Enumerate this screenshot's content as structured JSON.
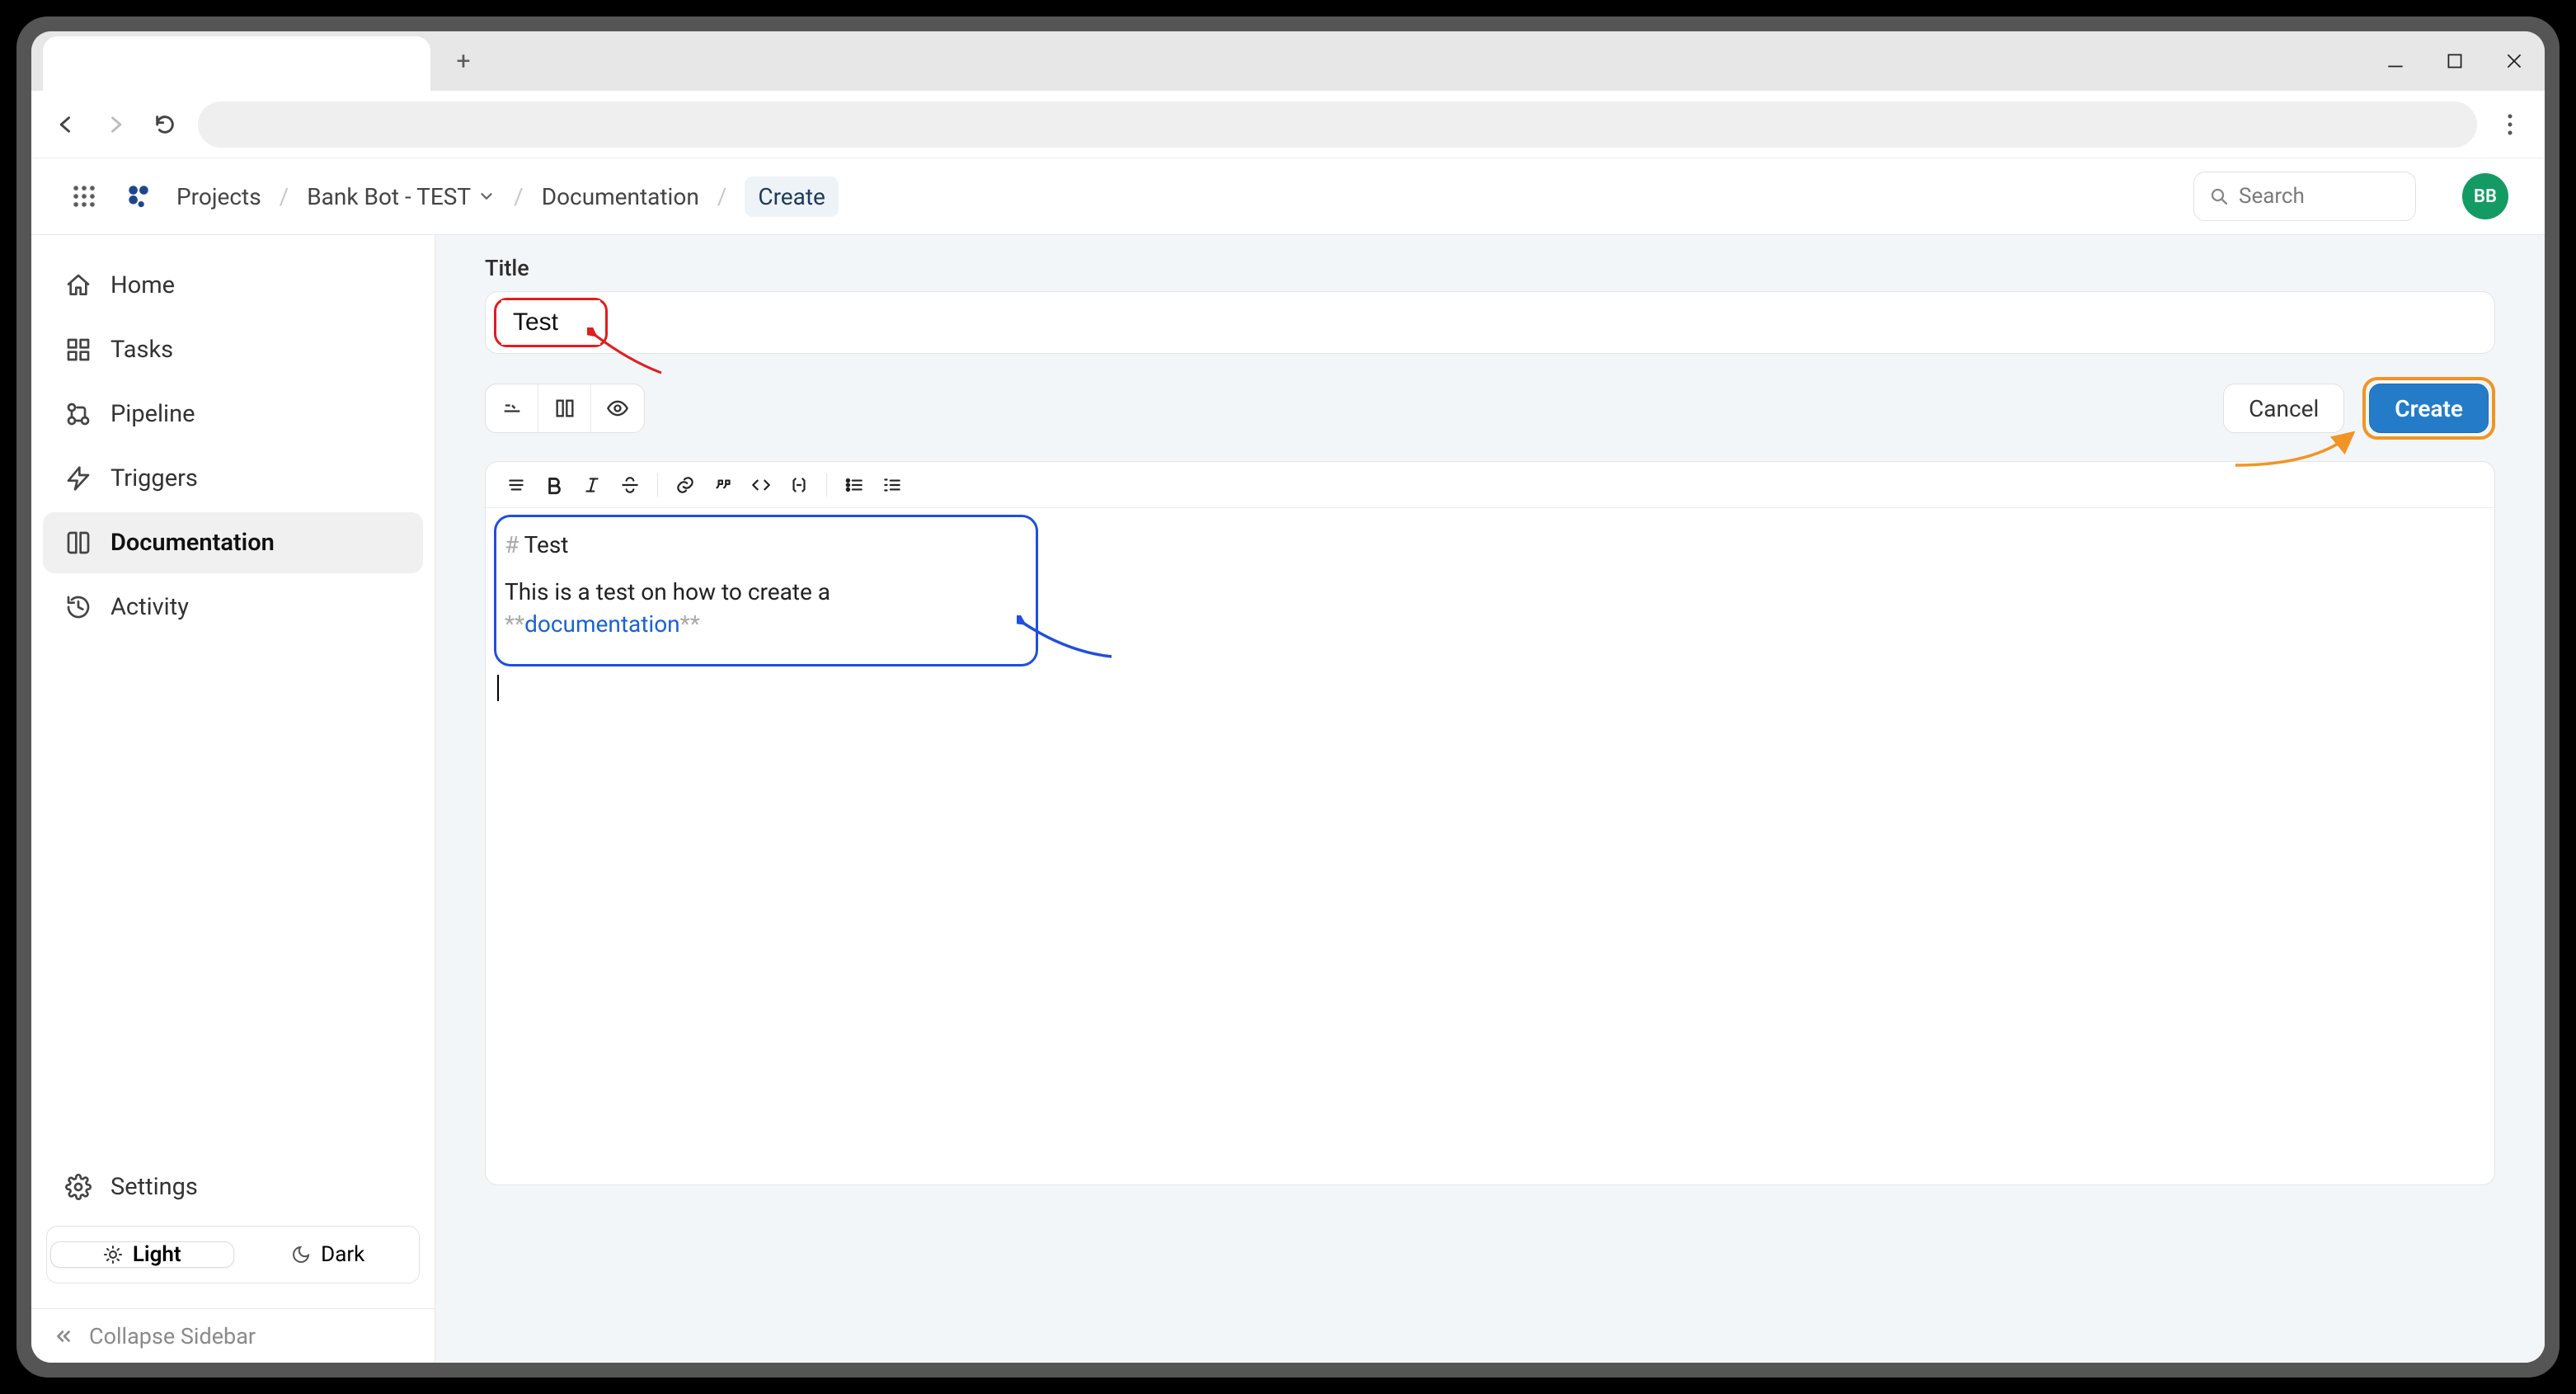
{
  "window": {
    "newtab_plus": "+"
  },
  "header": {
    "breadcrumbs": {
      "projects": "Projects",
      "project_name": "Bank Bot - TEST",
      "section": "Documentation",
      "current": "Create"
    },
    "search_placeholder": "Search",
    "avatar_initials": "BB"
  },
  "sidebar": {
    "items": {
      "home": "Home",
      "tasks": "Tasks",
      "pipeline": "Pipeline",
      "triggers": "Triggers",
      "documentation": "Documentation",
      "activity": "Activity"
    },
    "settings": "Settings",
    "theme": {
      "light": "Light",
      "dark": "Dark"
    },
    "collapse": "Collapse Sidebar"
  },
  "main": {
    "title_label": "Title",
    "title_value": "Test",
    "cancel": "Cancel",
    "create": "Create",
    "editor": {
      "line1_prefix": "#",
      "line1_text": " Test",
      "line2_before": "This is a test on how to create a ",
      "line2_stars": "**",
      "line2_link": "documentation",
      "line2_stars_close": "**"
    }
  }
}
